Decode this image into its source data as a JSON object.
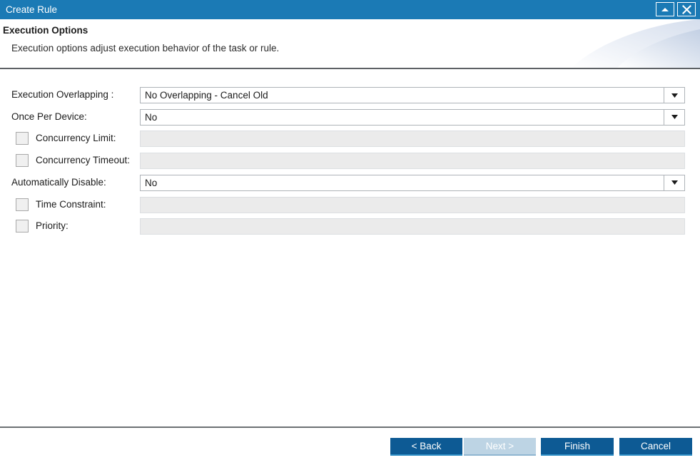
{
  "window": {
    "title": "Create Rule",
    "controls": [
      {
        "name": "collapse-button",
        "icon": "caret-up-icon",
        "label": ""
      },
      {
        "name": "close-button",
        "icon": "close-x-icon",
        "label": ""
      }
    ]
  },
  "header": {
    "title": "Execution Options",
    "description": "Execution options adjust execution behavior of the task or rule."
  },
  "form": {
    "rows": [
      {
        "name": "execution-overlapping",
        "label": "Execution Overlapping :",
        "control": "dropdown",
        "value": "No Overlapping - Cancel Old",
        "enabled": true,
        "checkbox": false
      },
      {
        "name": "once-per-device",
        "label": "Once Per Device:",
        "control": "dropdown",
        "value": "No",
        "enabled": true,
        "checkbox": false
      },
      {
        "name": "concurrency-limit",
        "label": "Concurrency Limit:",
        "control": "text",
        "value": "",
        "enabled": false,
        "checkbox": true,
        "checked": false
      },
      {
        "name": "concurrency-timeout",
        "label": "Concurrency Timeout:",
        "control": "text",
        "value": "",
        "enabled": false,
        "checkbox": true,
        "checked": false
      },
      {
        "name": "automatically-disable",
        "label": "Automatically Disable:",
        "control": "dropdown",
        "value": "No",
        "enabled": true,
        "checkbox": false
      },
      {
        "name": "time-constraint",
        "label": "Time Constraint:",
        "control": "text",
        "value": "",
        "enabled": false,
        "checkbox": true,
        "checked": false
      },
      {
        "name": "priority",
        "label": "Priority:",
        "control": "text",
        "value": "",
        "enabled": false,
        "checkbox": true,
        "checked": false
      }
    ]
  },
  "footer": {
    "buttons": [
      {
        "name": "back-button",
        "label": "< Back",
        "state": "enabled"
      },
      {
        "name": "next-button",
        "label": "Next >",
        "state": "disabled"
      },
      {
        "name": "finish-button",
        "label": "Finish",
        "state": "enabled"
      },
      {
        "name": "cancel-button",
        "label": "Cancel",
        "state": "enabled"
      }
    ]
  },
  "colors": {
    "titlebar": "#1b7ab5",
    "button_primary": "#0d5a94",
    "button_disabled": "#bdd4e4",
    "field_disabled": "#ebebeb",
    "separator": "#5d6165"
  }
}
